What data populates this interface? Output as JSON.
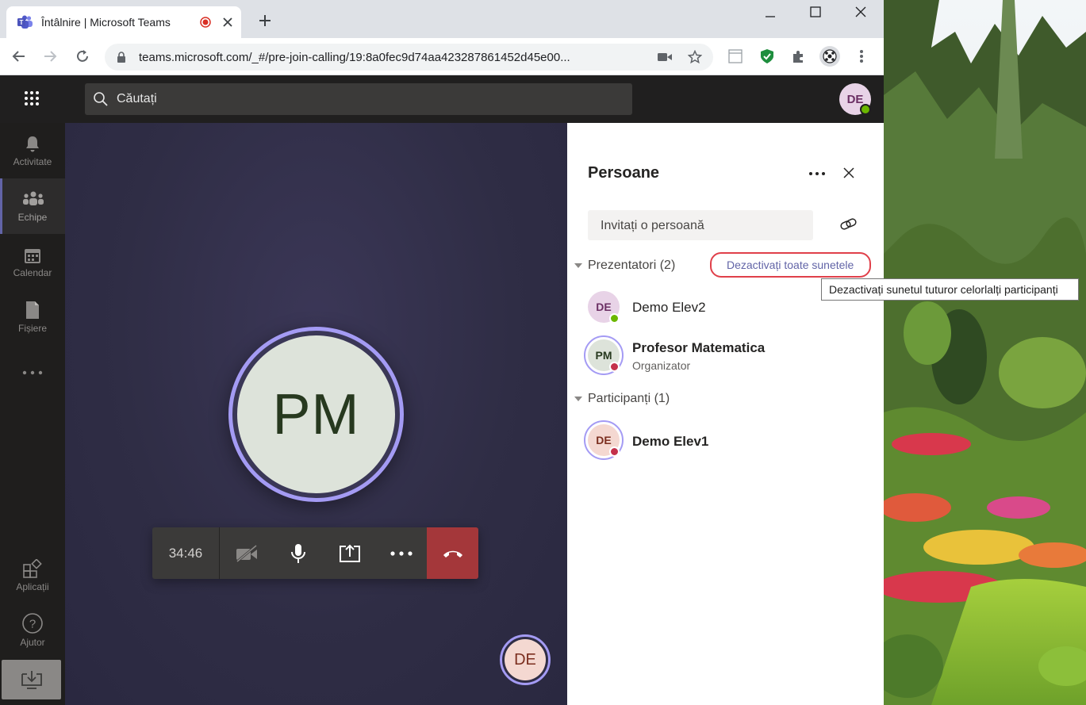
{
  "browser": {
    "tab_title": "Întâlnire | Microsoft Teams",
    "url": "teams.microsoft.com/_#/pre-join-calling/19:8a0fec9d74aa423287861452d45e00..."
  },
  "teams": {
    "search_placeholder": "Căutați",
    "user_initials": "DE",
    "rail": {
      "activity": "Activitate",
      "teams": "Echipe",
      "calendar": "Calendar",
      "files": "Fișiere",
      "apps": "Aplicații",
      "help": "Ajutor"
    }
  },
  "call": {
    "presenter_initials": "PM",
    "timer": "34:46",
    "self_initials": "DE"
  },
  "people_panel": {
    "title": "Persoane",
    "invite_placeholder": "Invitați o persoană",
    "presenters_label": "Prezentatori (2)",
    "mute_all_label": "Dezactivați toate sunetele",
    "tooltip": "Dezactivați sunetul tuturor celorlalți participanți",
    "participants_label": "Participanți (1)",
    "presenters": [
      {
        "initials": "DE",
        "name": "Demo Elev2",
        "role": ""
      },
      {
        "initials": "PM",
        "name": "Profesor Matematica",
        "role": "Organizator"
      }
    ],
    "participants": [
      {
        "initials": "DE",
        "name": "Demo Elev1"
      }
    ]
  },
  "colors": {
    "accent": "#6264a7",
    "ring": "#a49bf4",
    "hangup": "#a4373a",
    "status_available": "#6bb700",
    "status_busy": "#c4314b",
    "highlight": "#e0404a"
  }
}
